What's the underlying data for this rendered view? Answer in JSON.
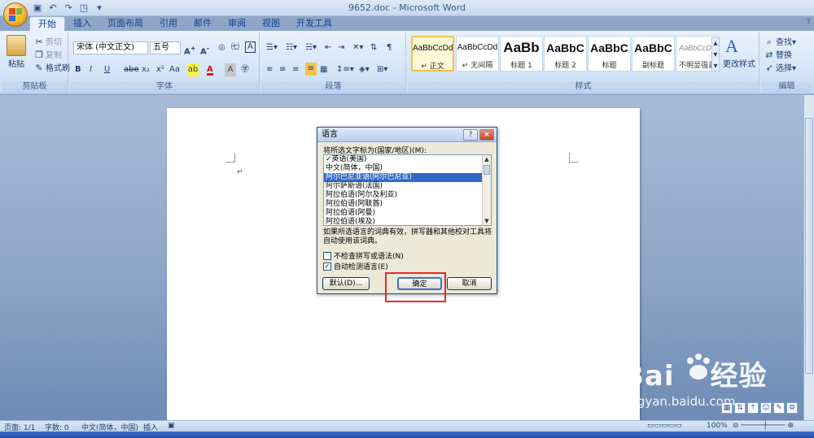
{
  "window": {
    "title": "9652.doc - Microsoft Word"
  },
  "quick_access": {
    "icons": [
      "save-icon",
      "undo-icon",
      "redo-icon",
      "print-preview-icon"
    ]
  },
  "tabs": [
    {
      "label": "开始"
    },
    {
      "label": "插入"
    },
    {
      "label": "页面布局"
    },
    {
      "label": "引用"
    },
    {
      "label": "邮件"
    },
    {
      "label": "审阅"
    },
    {
      "label": "视图"
    },
    {
      "label": "开发工具"
    }
  ],
  "ribbon": {
    "clipboard": {
      "label": "剪贴板",
      "paste": "粘贴",
      "cut": "剪切",
      "copy": "复制",
      "format_painter": "格式刷"
    },
    "font": {
      "label": "字体",
      "font_name": "宋体 (中文正文)",
      "font_size": "五号",
      "bold": "B",
      "italic": "I",
      "underline": "U",
      "strike": "abe",
      "subscript": "x₂",
      "superscript": "x²",
      "change_case": "Aa",
      "grow": "A",
      "shrink": "A",
      "font_color_letter": "A",
      "char_border": "A"
    },
    "paragraph": {
      "label": "段落"
    },
    "styles": {
      "label": "样式",
      "items": [
        {
          "sample": "AaBbCcDd",
          "name": "↵ 正文"
        },
        {
          "sample": "AaBbCcDd",
          "name": "↵ 无间隔"
        },
        {
          "sample": "AaBb",
          "name": "标题 1"
        },
        {
          "sample": "AaBbC",
          "name": "标题 2"
        },
        {
          "sample": "AaBbC",
          "name": "标题"
        },
        {
          "sample": "AaBbC",
          "name": "副标题"
        },
        {
          "sample": "AaBbCcDd",
          "name": "不明显强调"
        }
      ],
      "change_styles": "更改样式"
    },
    "editing": {
      "label": "编辑",
      "find": "查找",
      "replace": "替换",
      "select": "选择"
    }
  },
  "dialog": {
    "title": "语言",
    "help": "?",
    "close": "×",
    "list_label": "将所选文字标为(国家/地区)(M):",
    "languages": [
      {
        "label": "✓英语(美国)",
        "selected": false
      },
      {
        "label": "中文(简体，中国)",
        "selected": false
      },
      {
        "label": "阿尔巴尼亚语(阿尔巴尼亚)",
        "selected": true
      },
      {
        "label": "阿尔萨斯语(法国)",
        "selected": false
      },
      {
        "label": "阿拉伯语(阿尔及利亚)",
        "selected": false
      },
      {
        "label": "阿拉伯语(阿联酋)",
        "selected": false
      },
      {
        "label": "阿拉伯语(阿曼)",
        "selected": false
      },
      {
        "label": "阿拉伯语(埃及)",
        "selected": false
      }
    ],
    "note": "如果所选语言的词典有效，拼写器和其他校对工具将自动使用该词典。",
    "no_spellcheck": {
      "label": "不检查拼写或语法(N)",
      "checked": false
    },
    "auto_detect": {
      "label": "自动检测语言(E)",
      "checked": true
    },
    "default_button": "默认(D)...",
    "ok_button": "确定",
    "cancel_button": "取消"
  },
  "statusbar": {
    "page": "页面: 1/1",
    "words": "字数: 0",
    "language": "中文(简体，中国)",
    "mode": "插入",
    "zoom": "100%"
  },
  "watermark": {
    "brand": "Bai",
    "brand2": "经验",
    "url": "jingyan.baidu.com"
  }
}
